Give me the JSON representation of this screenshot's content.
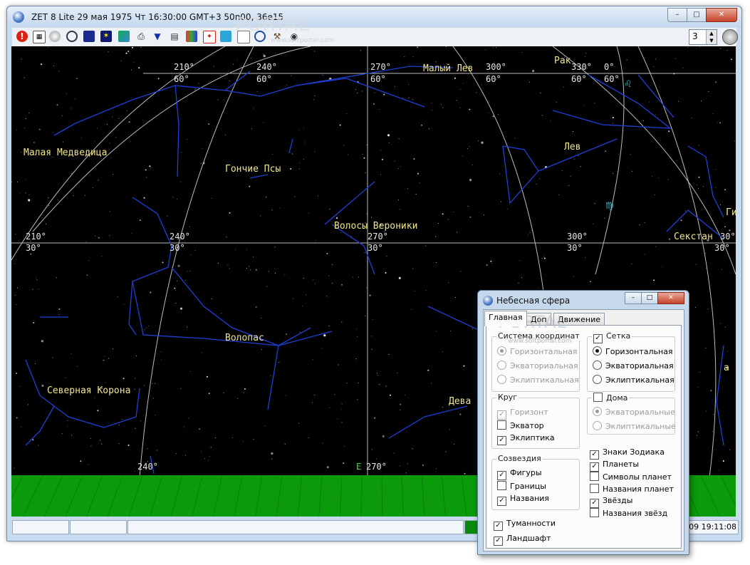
{
  "window": {
    "title": "ZET 8 Lite  29 мая 1975  Чт  16:30:00 GMT+3 50n00, 36e15",
    "controls": {
      "minimize": "–",
      "maximize": "□",
      "close": "✕"
    }
  },
  "toolbar": {
    "icons": [
      "stop-icon",
      "calendar-icon",
      "clock-icon",
      "compass-icon",
      "sky-icon",
      "galaxy-icon",
      "map-icon",
      "print-icon",
      "filter-icon",
      "page-icon",
      "table-icon",
      "star-card-icon",
      "star-map-icon",
      "list-icon",
      "target-icon",
      "tools-icon",
      "camera-icon"
    ],
    "spin_value": "3"
  },
  "sky": {
    "grid_labels": [
      {
        "text": "210°"
      },
      {
        "text": "60°"
      },
      {
        "text": "240°"
      },
      {
        "text": "60°"
      },
      {
        "text": "270°"
      },
      {
        "text": "60°"
      },
      {
        "text": "300°"
      },
      {
        "text": "60°"
      },
      {
        "text": "330°"
      },
      {
        "text": "0°"
      },
      {
        "text": "60°"
      },
      {
        "text": "60°"
      },
      {
        "text": "210°"
      },
      {
        "text": "30°"
      },
      {
        "text": "240°"
      },
      {
        "text": "30°"
      },
      {
        "text": "270°"
      },
      {
        "text": "30°"
      },
      {
        "text": "300°"
      },
      {
        "text": "30°"
      },
      {
        "text": "30°"
      },
      {
        "text": "30°"
      },
      {
        "text": "240°"
      },
      {
        "text": "270°"
      }
    ],
    "horizon_marker": "E",
    "constellations": [
      "Малая Медведица",
      "Гончие Псы",
      "Волосы Вероники",
      "Волопас",
      "Северная Корона",
      "Дева",
      "Малый Лев",
      "Рак",
      "Лев",
      "Секстан",
      "Ги",
      "а"
    ],
    "zodiac_symbols": [
      "♌",
      "♍"
    ]
  },
  "watermark": {
    "main": "PORTAL",
    "sub": "www.softportal.com"
  },
  "statusbar": {
    "fields": [
      "",
      "",
      "",
      ""
    ],
    "datetime": ".09 19:11:08"
  },
  "dialog": {
    "title": "Небесная сфера",
    "tabs": [
      "Главная",
      "Доп",
      "Движение"
    ],
    "coord_system": {
      "label": "Система координат",
      "options": [
        "Горизонтальная",
        "Экваториальная",
        "Эклиптикальная"
      ],
      "selected": 0
    },
    "grid": {
      "label": "Сетка",
      "checked": true,
      "options": [
        "Горизонтальная",
        "Экваториальная",
        "Эклиптикальная"
      ],
      "selected": 0
    },
    "circle": {
      "label": "Круг",
      "items": [
        {
          "label": "Горизонт",
          "checked": true,
          "disabled": true
        },
        {
          "label": "Экватор",
          "checked": false,
          "disabled": false
        },
        {
          "label": "Эклиптика",
          "checked": true,
          "disabled": false
        }
      ]
    },
    "houses": {
      "label": "Дома",
      "checked": false,
      "options": [
        "Экваториальные",
        "Эклиптикальные"
      ],
      "selected": 0
    },
    "constellations": {
      "label": "Созвездия",
      "items": [
        {
          "label": "Фигуры",
          "checked": true
        },
        {
          "label": "Границы",
          "checked": false
        },
        {
          "label": "Названия",
          "checked": true
        }
      ]
    },
    "right_checks": [
      {
        "label": "Знаки Зодиака",
        "checked": true
      },
      {
        "label": "Планеты",
        "checked": true
      },
      {
        "label": "Символы планет",
        "checked": false
      },
      {
        "label": "Названия планет",
        "checked": false
      },
      {
        "label": "Звёзды",
        "checked": true
      },
      {
        "label": "Названия звёзд",
        "checked": false
      }
    ],
    "bottom_checks": [
      {
        "label": "Туманности",
        "checked": true
      },
      {
        "label": "Ландшафт",
        "checked": true
      }
    ]
  },
  "colors": {
    "sky": "#000000",
    "constellation_lines": "#1f3fd8",
    "labels": "#f0e68c",
    "grid": "#bdbdbd",
    "ground": "#0a9a0a",
    "zodiac": "#3fb7c7"
  }
}
